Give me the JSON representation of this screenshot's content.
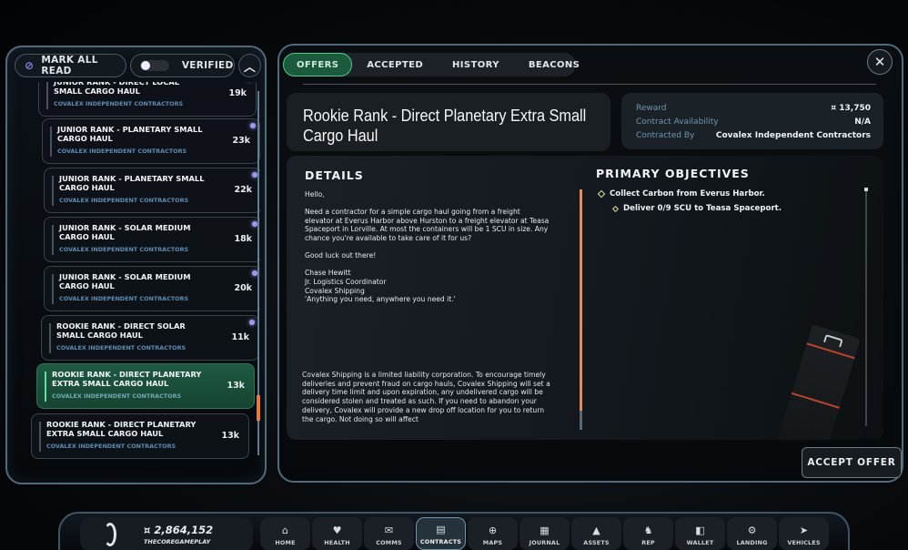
{
  "left_panel": {
    "mark_all_read_label": "MARK ALL READ",
    "mark_all_read_icon": "eye-slash-icon",
    "verified_label": "VERIFIED",
    "verified_toggle_on": false,
    "collapse_icon": "chevron-up-icon",
    "contracts": [
      {
        "title": "JUNIOR RANK - DIRECT LOCAL SMALL CARGO HAUL",
        "company": "COVALEX INDEPENDENT CONTRACTORS",
        "reward": "19k",
        "unread": true,
        "selected": false
      },
      {
        "title": "JUNIOR RANK - PLANETARY SMALL CARGO HAUL",
        "company": "COVALEX INDEPENDENT CONTRACTORS",
        "reward": "23k",
        "unread": true,
        "selected": false
      },
      {
        "title": "JUNIOR RANK - PLANETARY SMALL CARGO HAUL",
        "company": "COVALEX INDEPENDENT CONTRACTORS",
        "reward": "22k",
        "unread": true,
        "selected": false
      },
      {
        "title": "JUNIOR RANK - SOLAR MEDIUM CARGO HAUL",
        "company": "COVALEX INDEPENDENT CONTRACTORS",
        "reward": "18k",
        "unread": true,
        "selected": false
      },
      {
        "title": "JUNIOR RANK - SOLAR MEDIUM CARGO HAUL",
        "company": "COVALEX INDEPENDENT CONTRACTORS",
        "reward": "20k",
        "unread": true,
        "selected": false
      },
      {
        "title": "ROOKIE RANK - DIRECT SOLAR SMALL CARGO HAUL",
        "company": "COVALEX INDEPENDENT CONTRACTORS",
        "reward": "11k",
        "unread": true,
        "selected": false
      },
      {
        "title": "ROOKIE RANK - DIRECT PLANETARY EXTRA SMALL CARGO HAUL",
        "company": "COVALEX INDEPENDENT CONTRACTORS",
        "reward": "13k",
        "unread": false,
        "selected": true
      },
      {
        "title": "ROOKIE RANK - DIRECT PLANETARY EXTRA SMALL CARGO HAUL",
        "company": "COVALEX INDEPENDENT CONTRACTORS",
        "reward": "13k",
        "unread": false,
        "selected": false
      }
    ]
  },
  "tabs": [
    {
      "label": "OFFERS",
      "active": true
    },
    {
      "label": "ACCEPTED",
      "active": false
    },
    {
      "label": "HISTORY",
      "active": false
    },
    {
      "label": "BEACONS",
      "active": false
    }
  ],
  "close_icon": "close-icon",
  "contract_detail": {
    "title": "Rookie Rank - Direct Planetary Extra Small Cargo Haul",
    "meta": [
      {
        "key": "Reward",
        "value": "¤ 13,750"
      },
      {
        "key": "Contract Availability",
        "value": "N/A"
      },
      {
        "key": "Contracted By",
        "value": "Covalex Independent Contractors"
      }
    ],
    "details_heading": "DETAILS",
    "greeting": "Hello,",
    "body": "Need a contractor for a simple cargo haul going from a freight elevator at Everus Harbor above Hurston to a freight elevator at Teasa Spaceport in Lorville. At most the containers will be 1 SCU in size. Any chance you're available to take care of it for us?",
    "closing": "Good luck out there!",
    "signature": [
      "Chase Hewitt",
      "Jr. Logistics Coordinator",
      "Covalex Shipping",
      "'Anything you need, anywhere you need it.'"
    ],
    "legal": "Covalex Shipping is a limited liability corporation. To encourage timely deliveries and prevent fraud on cargo hauls, Covalex Shipping will set a delivery time limit and upon expiration, any undelivered cargo will be considered stolen and treated as such. If you need to abandon your delivery, Covalex will provide a new drop off location for you to return the cargo. Not doing so will affect",
    "objectives_heading": "PRIMARY OBJECTIVES",
    "objectives": [
      {
        "text": "Collect Carbon from Everus Harbor.",
        "level": 0
      },
      {
        "text": "Deliver 0/9 SCU to Teasa Spaceport.",
        "level": 1
      }
    ],
    "accept_label": "ACCEPT OFFER"
  },
  "bottom_bar": {
    "credits": "¤ 2,864,152",
    "handle": "THECOREGAMEPLAY",
    "nav": [
      {
        "label": "HOME",
        "icon": "home-icon",
        "glyph": "⌂",
        "active": false
      },
      {
        "label": "HEALTH",
        "icon": "health-icon",
        "glyph": "♥",
        "active": false
      },
      {
        "label": "COMMS",
        "icon": "comms-icon",
        "glyph": "✉",
        "active": false
      },
      {
        "label": "CONTRACTS",
        "icon": "contracts-icon",
        "glyph": "▤",
        "active": true
      },
      {
        "label": "MAPS",
        "icon": "maps-icon",
        "glyph": "⊕",
        "active": false
      },
      {
        "label": "JOURNAL",
        "icon": "journal-icon",
        "glyph": "▦",
        "active": false
      },
      {
        "label": "ASSETS",
        "icon": "assets-icon",
        "glyph": "▲",
        "active": false
      },
      {
        "label": "REP",
        "icon": "rep-icon",
        "glyph": "♞",
        "active": false
      },
      {
        "label": "WALLET",
        "icon": "wallet-icon",
        "glyph": "◧",
        "active": false
      },
      {
        "label": "LANDING",
        "icon": "landing-icon",
        "glyph": "⚙",
        "active": false
      },
      {
        "label": "VEHICLES",
        "icon": "vehicles-icon",
        "glyph": "➤",
        "active": false
      }
    ]
  },
  "colors": {
    "accent_green": "#4cc98b",
    "accent_orange": "#f08a50",
    "unread_dot": "#9c9af0",
    "company_blue": "#5d8db4"
  }
}
